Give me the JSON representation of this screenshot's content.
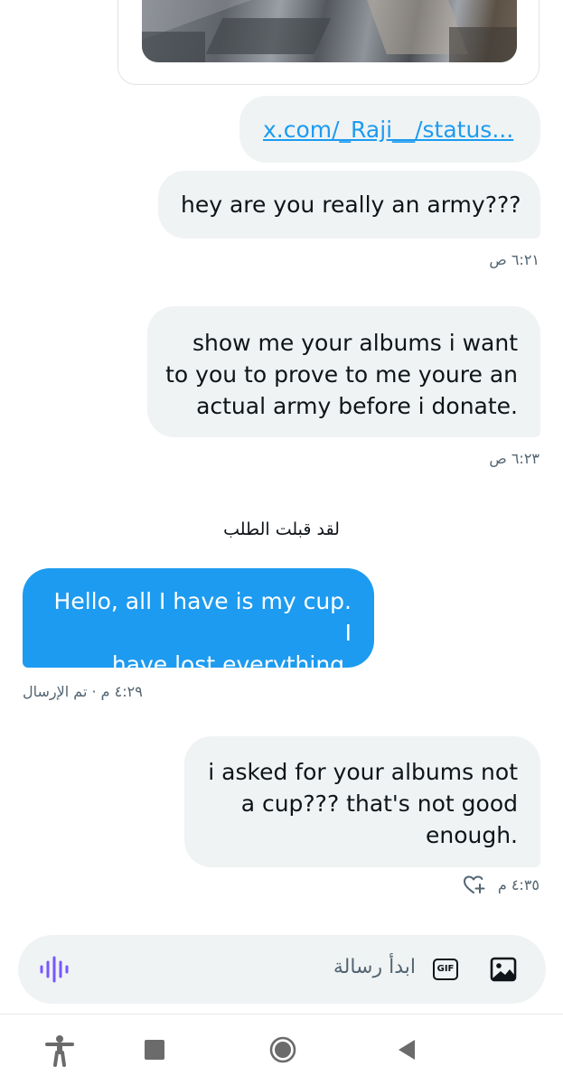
{
  "conversation": {
    "link_preview": {
      "url_text": "x.com/_Raji__/status..."
    },
    "messages": [
      {
        "direction": "sent",
        "lines": [
          "hey are you really an army???"
        ],
        "time": "٦:٢١ ص"
      },
      {
        "direction": "sent",
        "lines": [
          "show me your albums i want",
          "to you to prove to me youre an",
          "actual army before i donate."
        ],
        "time": "٦:٢٣ ص"
      },
      {
        "direction": "received",
        "lines": [
          "Hello, all I have is my cup. I",
          "have lost everything."
        ],
        "time": "٤:٢٩ م · تم الإرسال"
      },
      {
        "direction": "sent",
        "lines": [
          "i asked for your albums not",
          "a cup??? that's not good",
          "enough."
        ],
        "time": "٤:٣٥ م"
      }
    ],
    "system_note": "لقد قبلت الطلب"
  },
  "composer": {
    "placeholder": "ابدأ رسالة",
    "gif_label": "GIF",
    "icons": {
      "voice": "voice-wave-icon",
      "gif": "gif-icon",
      "media": "image-icon",
      "react": "heart-plus-icon"
    }
  },
  "navbar": {
    "icons": [
      "accessibility-icon",
      "recents-icon",
      "home-icon",
      "back-icon"
    ]
  },
  "colors": {
    "accent": "#1d9bf0",
    "bubble_gray": "#eff3f4",
    "text": "#0f1419",
    "muted": "#536471",
    "voice": "#7856ff"
  }
}
